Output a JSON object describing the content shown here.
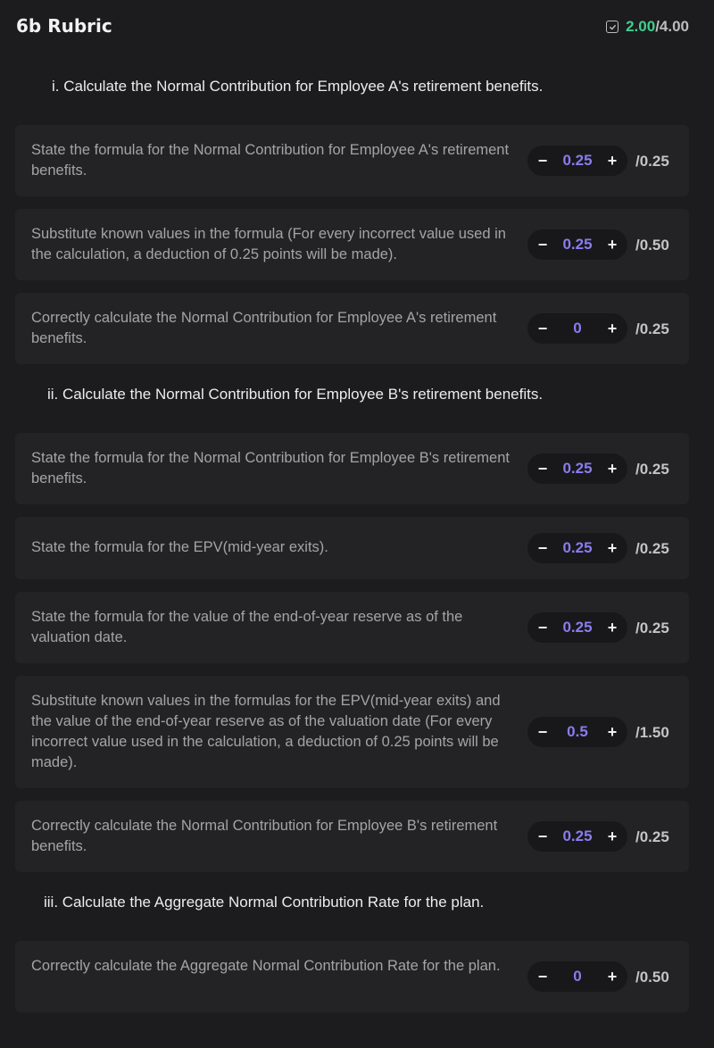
{
  "header": {
    "title": "6b Rubric",
    "score_earned": "2.00",
    "score_total": "/4.00",
    "icon": "checkbox-icon"
  },
  "colors": {
    "background": "#1c1c1e",
    "card": "#232325",
    "accent_green": "#3ecf8e",
    "accent_purple": "#8a7cf0"
  },
  "sections": [
    {
      "label": "i. Calculate the Normal Contribution for Employee A's retirement benefits."
    },
    {
      "label": "ii. Calculate the Normal Contribution for Employee B's retirement benefits."
    },
    {
      "label": "iii. Calculate the Aggregate Normal Contribution Rate for the plan."
    }
  ],
  "stepper": {
    "minus": "−",
    "plus": "+"
  },
  "criteria": [
    {
      "desc": "State the formula for the Normal Contribution for Employee A's retirement benefits.",
      "value": "0.25",
      "max": "/0.25"
    },
    {
      "desc": "Substitute known values in the formula (For every incorrect value used in the calculation, a deduction of 0.25 points will be made).",
      "value": "0.25",
      "max": "/0.50"
    },
    {
      "desc": "Correctly calculate the Normal Contribution for Employee A's retirement benefits.",
      "value": "0",
      "max": "/0.25"
    },
    {
      "desc": "State the formula for the Normal Contribution for Employee B's retirement benefits.",
      "value": "0.25",
      "max": "/0.25"
    },
    {
      "desc": "State the formula for the EPV(mid-year exits).",
      "value": "0.25",
      "max": "/0.25"
    },
    {
      "desc": "State the formula for the value of the end-of-year reserve as of the valuation date.",
      "value": "0.25",
      "max": "/0.25"
    },
    {
      "desc": "Substitute known values in the formulas for the EPV(mid-year exits) and the value of the end-of-year reserve as of the valuation date (For every incorrect value used in the calculation, a deduction of 0.25 points will be made).",
      "value": "0.5",
      "max": "/1.50"
    },
    {
      "desc": "Correctly calculate the Normal Contribution for Employee B's retirement benefits.",
      "value": "0.25",
      "max": "/0.25"
    },
    {
      "desc": "Correctly calculate the Aggregate Normal Contribution Rate for the plan.",
      "value": "0",
      "max": "/0.50"
    }
  ]
}
